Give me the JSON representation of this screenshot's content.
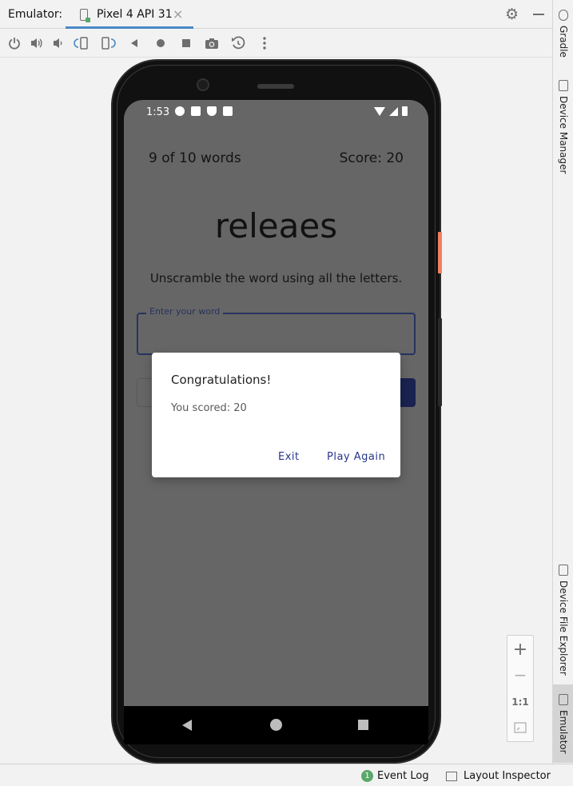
{
  "tool_window": {
    "title": "Emulator:",
    "tab_label": "Pixel 4 API 31",
    "tab_close": "×"
  },
  "toolbar": {
    "icons": [
      "power-icon",
      "volume-up-icon",
      "volume-down-icon",
      "rotate-left-icon",
      "rotate-right-icon",
      "back-icon",
      "home-icon",
      "overview-icon",
      "screenshot-icon",
      "snapshot-icon",
      "more-icon"
    ]
  },
  "right_stripe": {
    "gradle": "Gradle",
    "device_manager": "Device Manager",
    "device_file_explorer": "Device File Explorer",
    "emulator": "Emulator"
  },
  "zoom": {
    "plus": "+",
    "minus": "−",
    "one_to_one": "1:1"
  },
  "status_bar": {
    "event_log_count": "1",
    "event_log": "Event Log",
    "layout_inspector": "Layout Inspector"
  },
  "device": {
    "time": "1:53"
  },
  "app": {
    "word_count": "9 of 10 words",
    "score": "Score: 20",
    "scrambled_word": "releaes",
    "instructions": "Unscramble the word using all the letters.",
    "input_label": "Enter your word",
    "input_value": ""
  },
  "dialog": {
    "title": "Congratulations!",
    "message": "You scored: 20",
    "exit_label": "Exit",
    "play_again_label": "Play Again"
  },
  "colors": {
    "accent": "#4a88c7",
    "dialog_button": "#27358a",
    "scrim": "#666666",
    "submit_button": "#1a2250"
  }
}
